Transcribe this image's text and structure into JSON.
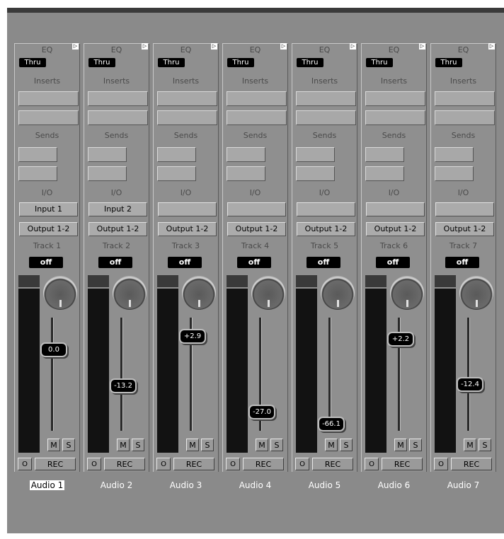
{
  "labels": {
    "eq": "EQ",
    "inserts": "Inserts",
    "sends": "Sends",
    "io": "I/O",
    "mute": "M",
    "solo": "S",
    "o": "O",
    "rec": "REC"
  },
  "colors": {
    "background": "#8a8a8a",
    "display": "#000000",
    "meter": "#121212"
  },
  "icons": {
    "corner": "expand-triangle-icon",
    "knob": "pan-knob-icon"
  },
  "channels": [
    {
      "eq": "Thru",
      "input": "Input 1",
      "output": "Output 1-2",
      "track": "Track 1",
      "automation": "off",
      "fader": "0.0",
      "fader_level": 0.72,
      "name": "Audio 1",
      "selected": true
    },
    {
      "eq": "Thru",
      "input": "Input 2",
      "output": "Output 1-2",
      "track": "Track 2",
      "automation": "off",
      "fader": "-13.2",
      "fader_level": 0.4,
      "name": "Audio 2",
      "selected": false
    },
    {
      "eq": "Thru",
      "input": "",
      "output": "Output 1-2",
      "track": "Track 3",
      "automation": "off",
      "fader": "+2.9",
      "fader_level": 0.84,
      "name": "Audio 3",
      "selected": false
    },
    {
      "eq": "Thru",
      "input": "",
      "output": "Output 1-2",
      "track": "Track 4",
      "automation": "off",
      "fader": "-27.0",
      "fader_level": 0.17,
      "name": "Audio 4",
      "selected": false
    },
    {
      "eq": "Thru",
      "input": "",
      "output": "Output 1-2",
      "track": "Track 5",
      "automation": "off",
      "fader": "-66.1",
      "fader_level": 0.06,
      "name": "Audio 5",
      "selected": false
    },
    {
      "eq": "Thru",
      "input": "",
      "output": "Output 1-2",
      "track": "Track 6",
      "automation": "off",
      "fader": "+2.2",
      "fader_level": 0.81,
      "name": "Audio 6",
      "selected": false
    },
    {
      "eq": "Thru",
      "input": "",
      "output": "Output 1-2",
      "track": "Track 7",
      "automation": "off",
      "fader": "-12.4",
      "fader_level": 0.41,
      "name": "Audio 7",
      "selected": false
    }
  ]
}
